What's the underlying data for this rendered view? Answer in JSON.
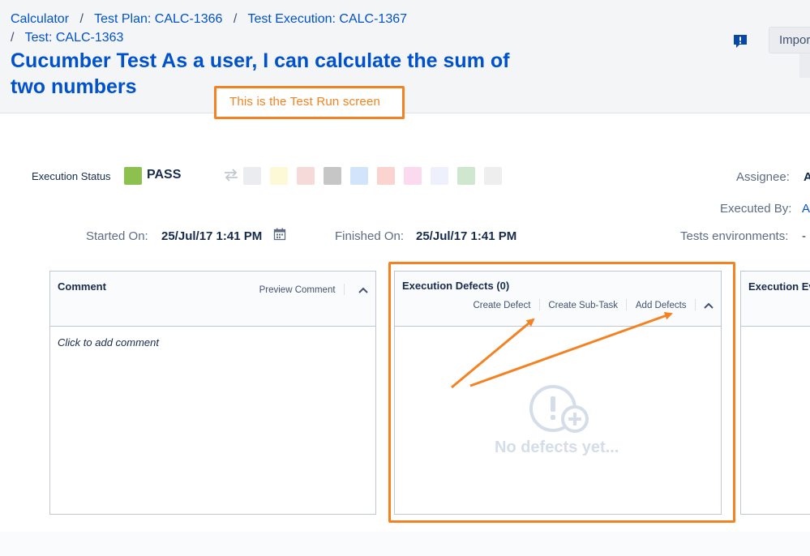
{
  "breadcrumb": {
    "items": [
      "Calculator",
      "Test Plan: CALC-1366",
      "Test Execution: CALC-1367",
      "Test: CALC-1363"
    ],
    "separator": "/"
  },
  "title": "Cucumber Test As a user, I can calculate the sum of two numbers",
  "header_actions": {
    "import_label": "Impor"
  },
  "annotation": {
    "text": "This is the Test Run screen"
  },
  "execution": {
    "status_label": "Execution Status",
    "status_value": "PASS",
    "status_color": "#8cc04f",
    "status_swatches": [
      "#ebecf0",
      "#fdf8d6",
      "#f6d9d9",
      "#c6c6c6",
      "#d2e3fc",
      "#fbd4cf",
      "#fbd9ee",
      "#eef0fb",
      "#cfe6cf",
      "#eeeeee"
    ]
  },
  "fields": {
    "assignee_label": "Assignee:",
    "assignee_value": "A",
    "executed_by_label": "Executed By:",
    "executed_by_value": "A",
    "tests_env_label": "Tests environments:",
    "tests_env_value": "-",
    "started_label": "Started On:",
    "started_value": "25/Jul/17 1:41 PM",
    "finished_label": "Finished On:",
    "finished_value": "25/Jul/17 1:41 PM"
  },
  "comment_panel": {
    "title": "Comment",
    "preview_label": "Preview Comment",
    "placeholder": "Click to add comment"
  },
  "defects_panel": {
    "title": "Execution Defects (0)",
    "actions": [
      "Create Defect",
      "Create Sub-Task",
      "Add Defects"
    ],
    "empty_text": "No defects yet..."
  },
  "evidence_panel": {
    "title": "Execution Ev"
  },
  "colors": {
    "accent": "#0052cc",
    "annotation": "#f58220"
  }
}
